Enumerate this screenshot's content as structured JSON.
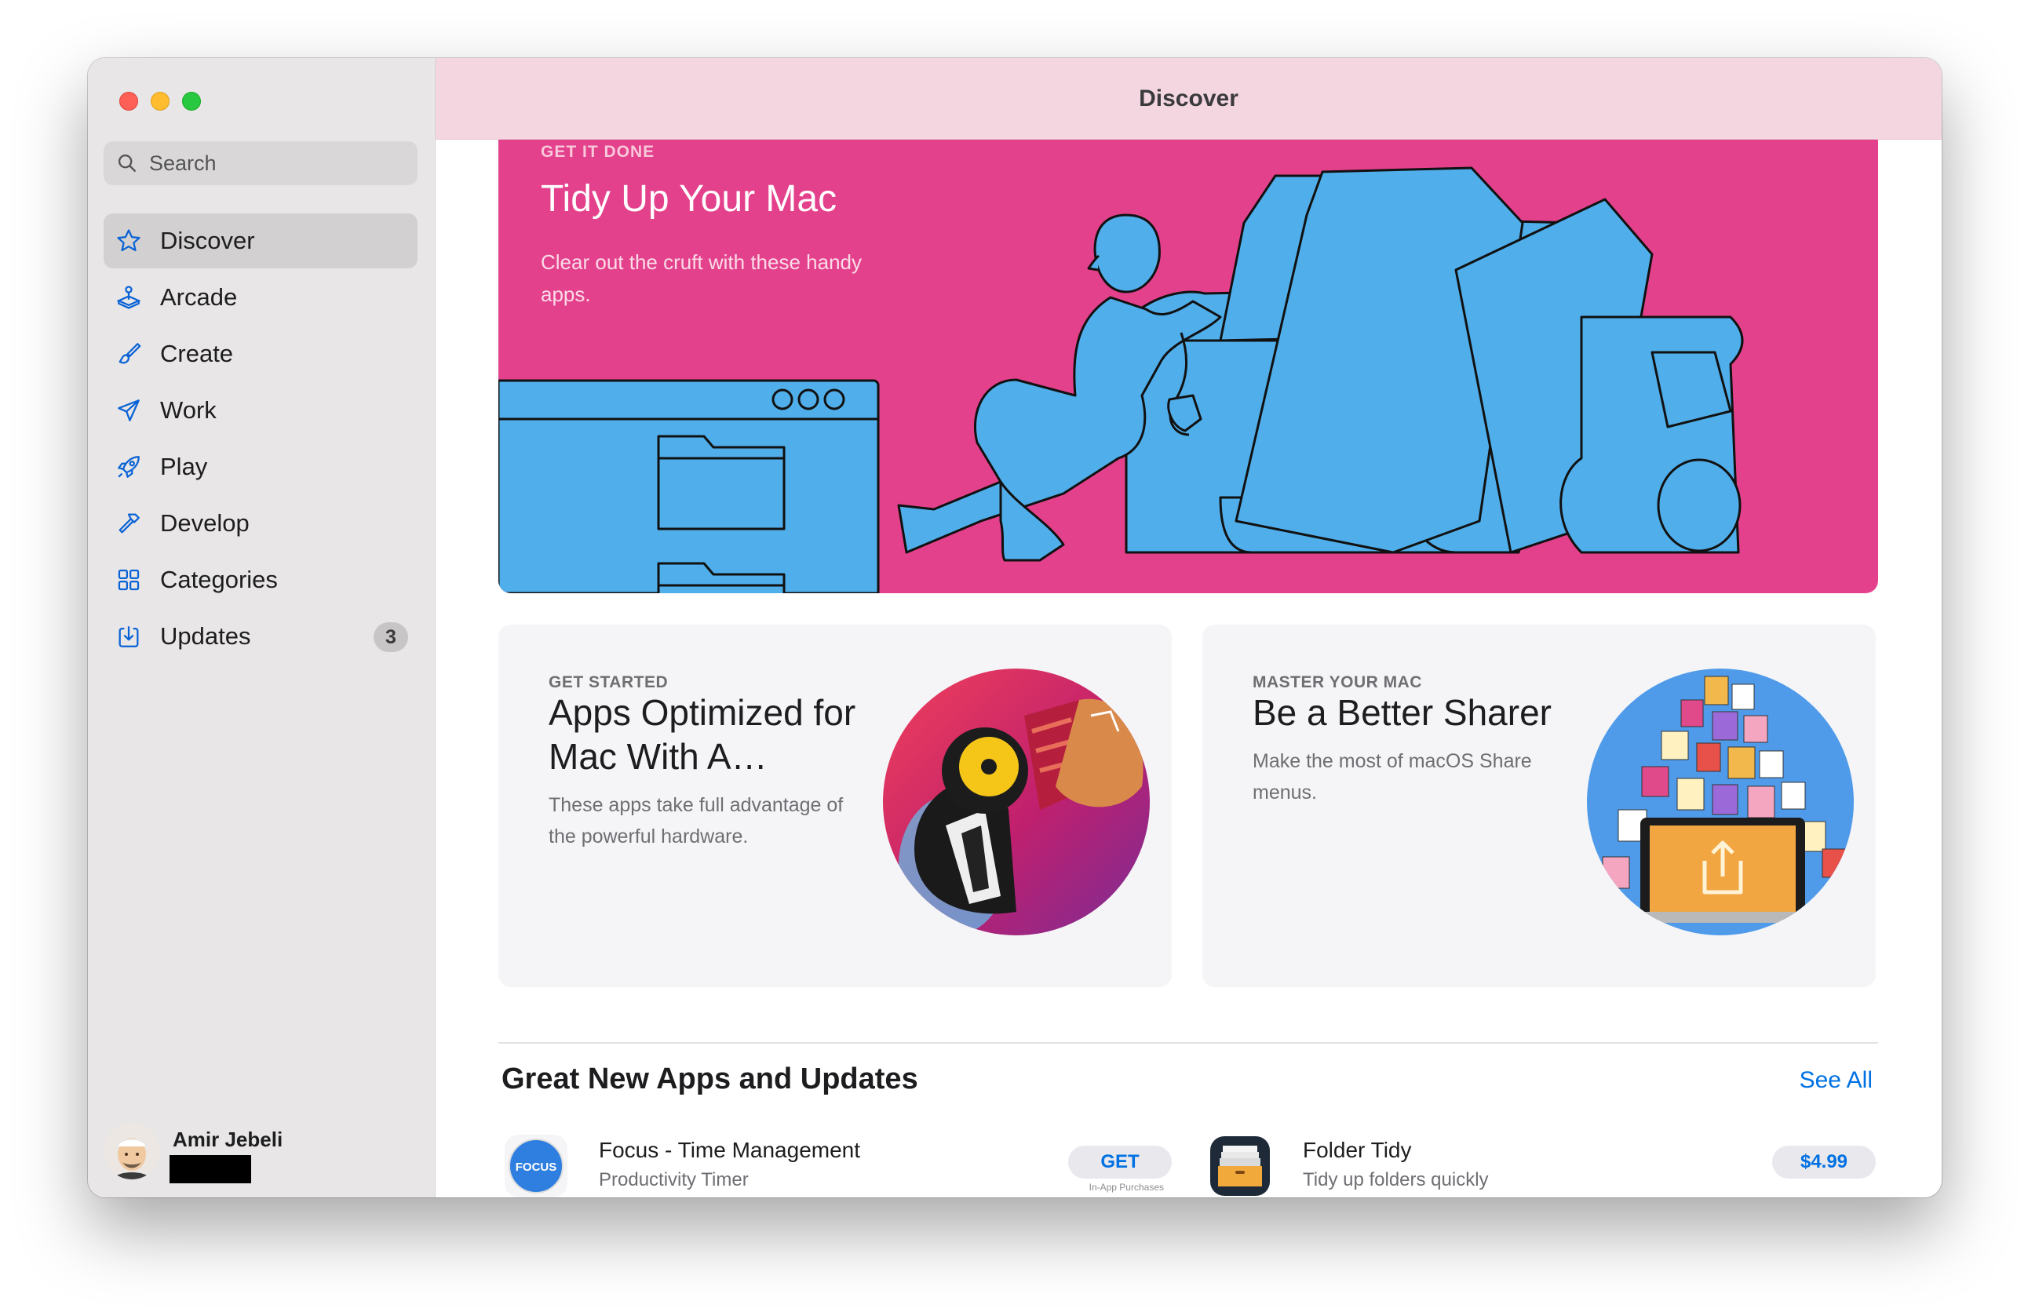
{
  "window": {
    "title": "Discover"
  },
  "sidebar": {
    "search_placeholder": "Search",
    "items": [
      {
        "label": "Discover",
        "icon": "star-icon",
        "active": true
      },
      {
        "label": "Arcade",
        "icon": "joystick-icon"
      },
      {
        "label": "Create",
        "icon": "paintbrush-icon"
      },
      {
        "label": "Work",
        "icon": "paperplane-icon"
      },
      {
        "label": "Play",
        "icon": "rocket-icon"
      },
      {
        "label": "Develop",
        "icon": "hammer-icon"
      },
      {
        "label": "Categories",
        "icon": "grid-icon"
      },
      {
        "label": "Updates",
        "icon": "download-icon",
        "badge": "3"
      }
    ],
    "profile": {
      "name": "Amir Jebeli"
    }
  },
  "hero": {
    "eyebrow": "GET IT DONE",
    "title": "Tidy Up Your Mac",
    "subtitle": "Clear out the cruft with these handy apps."
  },
  "cards": [
    {
      "eyebrow": "GET STARTED",
      "title": "Apps Optimized for Mac With A…",
      "subtitle": "These apps take full advantage of the powerful hardware."
    },
    {
      "eyebrow": "MASTER YOUR MAC",
      "title": "Be a Better Sharer",
      "subtitle": "Make the most of macOS Share menus."
    }
  ],
  "section": {
    "title": "Great New Apps and Updates",
    "see_all": "See All"
  },
  "apps": [
    {
      "name": "Focus - Time Management",
      "subtitle": "Productivity Timer",
      "button": "GET",
      "note": "In-App Purchases",
      "icon_text": "FOCUS"
    },
    {
      "name": "Folder Tidy",
      "subtitle": "Tidy up folders quickly",
      "button": "$4.99"
    }
  ],
  "colors": {
    "accent": "#0071e3",
    "hero_bg": "#e4418c",
    "titlebar_bg": "#f4d6e1"
  }
}
